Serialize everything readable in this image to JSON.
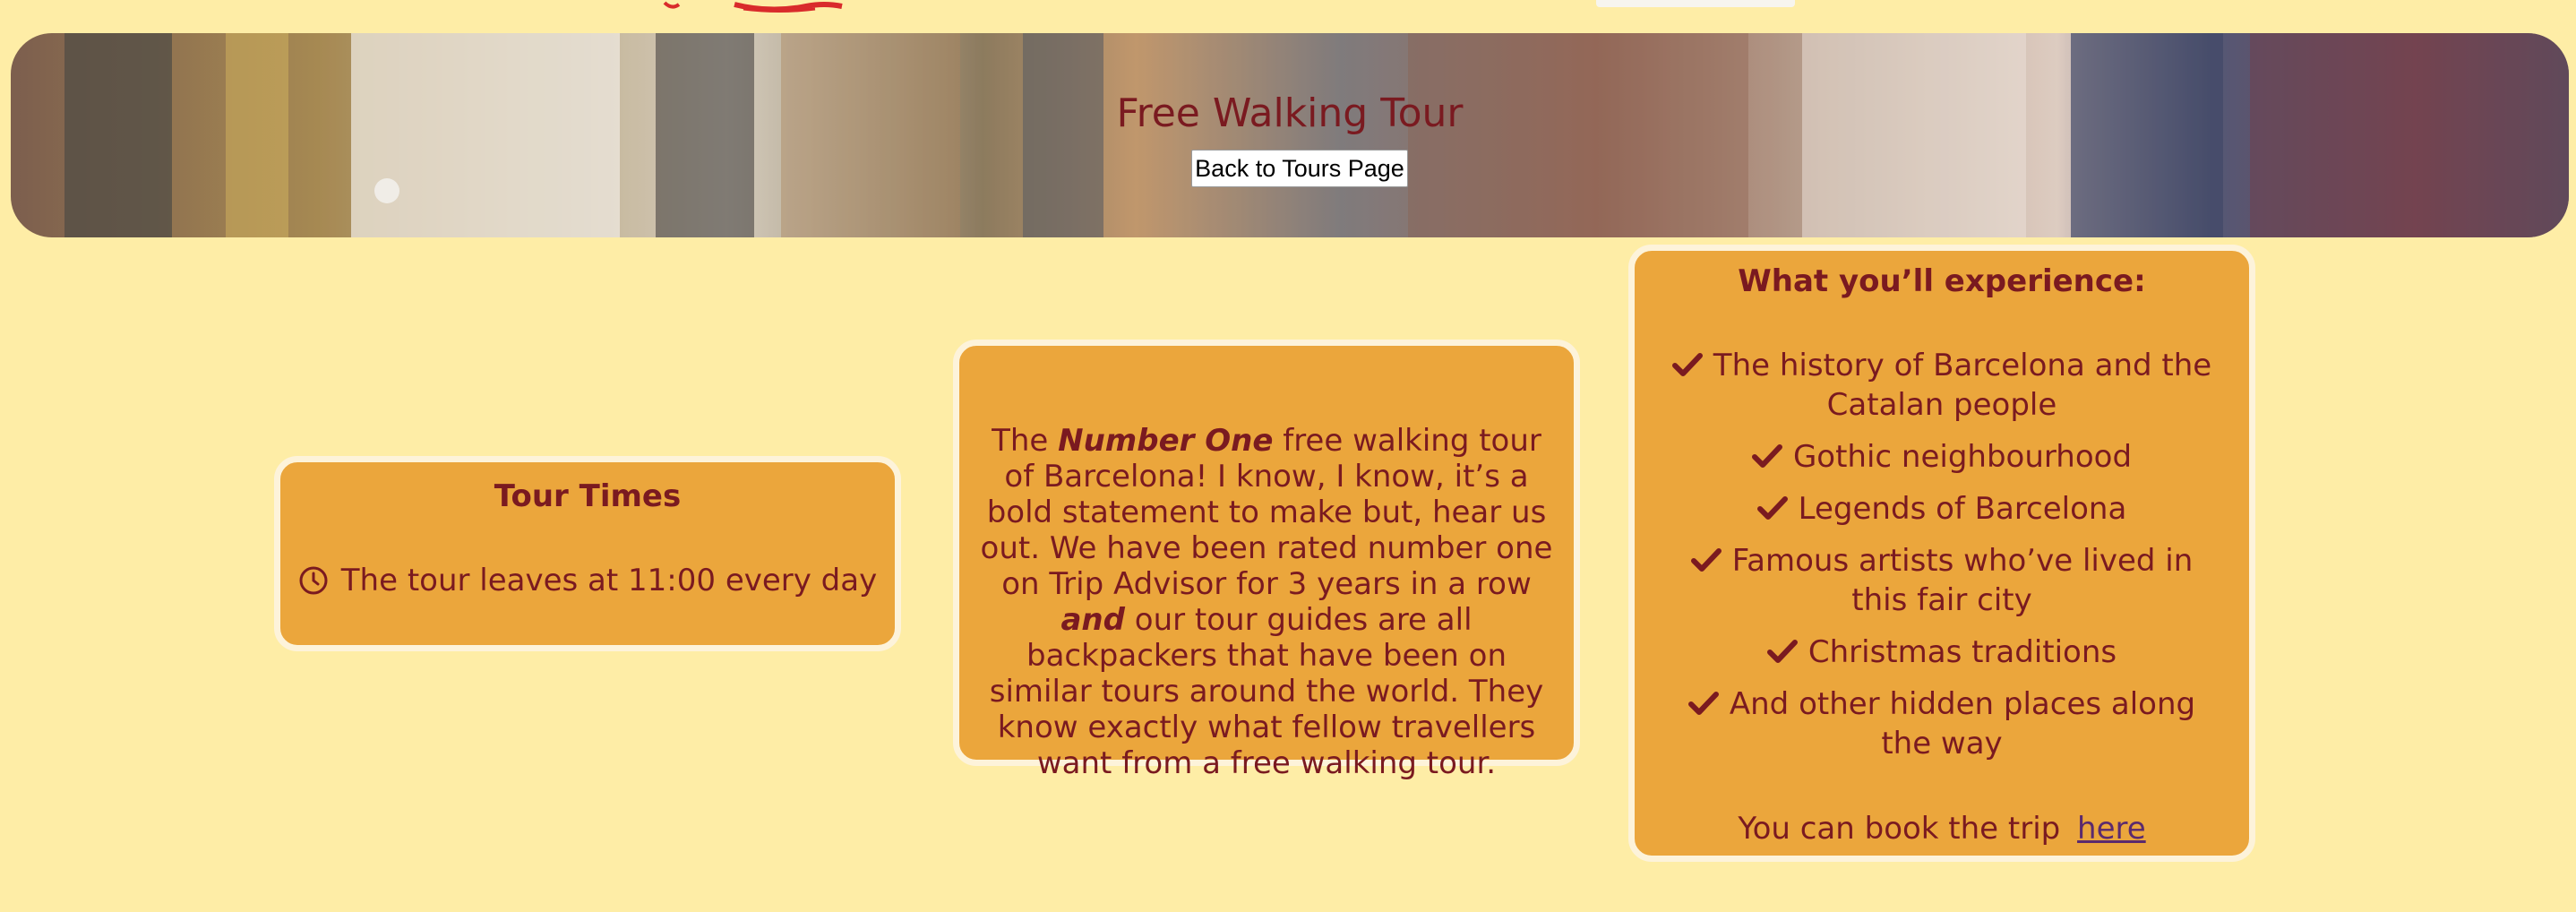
{
  "hero": {
    "title": "Free Walking Tour",
    "back_button_label": "Back to Tours Page"
  },
  "tour_times": {
    "title": "Tour Times",
    "line": "The tour leaves at 11:00 every day",
    "icon": "clock-icon"
  },
  "about": {
    "pre": "The ",
    "emph1": "Number One",
    "mid": " free walking tour of Barcelona! I know, I know, it’s a bold statement to make but, hear us out. We have been rated number one on Trip Advisor for 3 years in a row ",
    "emph2": "and",
    "post": " our tour guides are all backpackers that have been on similar tours around the world. They know exactly what fellow travellers want from a free walking tour."
  },
  "experience": {
    "title": "What you’ll experience:",
    "items": [
      "The history of Barcelona and the Catalan people",
      "Gothic neighbourhood",
      "Legends of Barcelona",
      "Famous artists who’ve lived in this fair city",
      "Christmas traditions",
      "And other hidden places along the way"
    ],
    "item_icon": "check-icon",
    "book_text": "You can book the trip",
    "book_link": "here"
  },
  "colors": {
    "page_bg": "#FEEDA6",
    "card_bg": "#EBA63C",
    "card_border": "#FDF3DA",
    "text": "#7A1A20",
    "link": "#5B2A6E"
  }
}
